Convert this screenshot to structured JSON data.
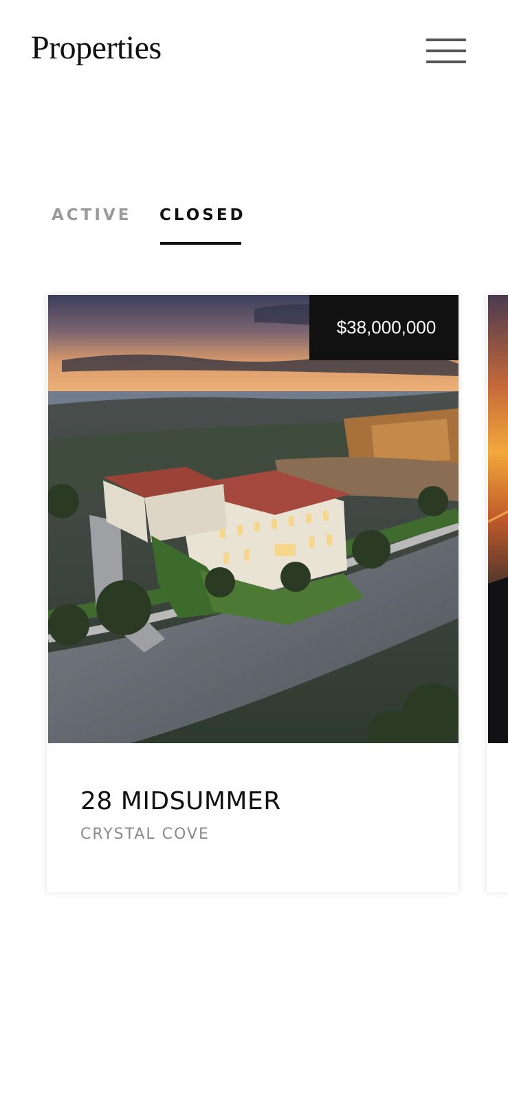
{
  "header": {
    "title": "Properties",
    "menu_icon": "hamburger-menu-icon"
  },
  "tabs": [
    {
      "label": "ACTIVE",
      "selected": false
    },
    {
      "label": "CLOSED",
      "selected": true
    }
  ],
  "listings": [
    {
      "price": "$38,000,000",
      "address": "28 MIDSUMMER",
      "location": "CRYSTAL COVE",
      "image": "aerial photo of mansion at dusk"
    }
  ],
  "colors": {
    "text": "#111111",
    "muted": "#8a8a8a",
    "badge_bg": "#111111"
  }
}
